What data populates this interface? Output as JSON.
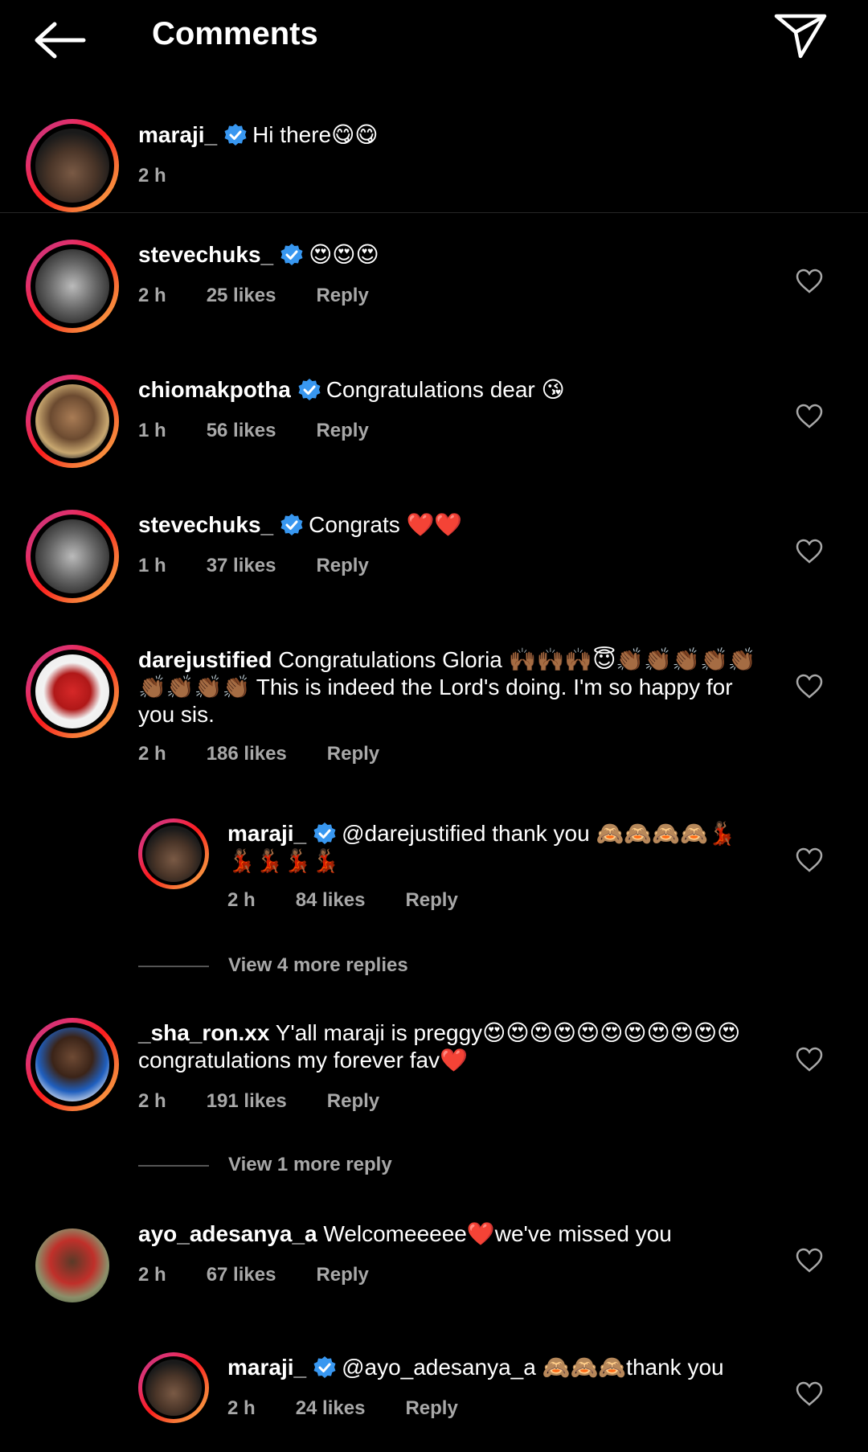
{
  "header": {
    "title": "Comments"
  },
  "caption": {
    "user": "maraji_",
    "text": "Hi there😋😋",
    "time": "2 h"
  },
  "comments": [
    {
      "user": "stevechuks_",
      "verified": true,
      "text": "😍😍😍",
      "time": "2 h",
      "likes": "25 likes",
      "reply": "Reply"
    },
    {
      "user": "chiomakpotha",
      "verified": true,
      "text": "Congratulations dear 😘",
      "time": "1 h",
      "likes": "56 likes",
      "reply": "Reply"
    },
    {
      "user": "stevechuks_",
      "verified": true,
      "text": "Congrats ❤️❤️",
      "time": "1 h",
      "likes": "37 likes",
      "reply": "Reply"
    },
    {
      "user": "darejustified",
      "verified": false,
      "text": "Congratulations Gloria 🙌🏾🙌🏾🙌🏾😇👏🏾👏🏾👏🏾👏🏾👏🏾👏🏾👏🏾👏🏾👏🏾 This is indeed the Lord's doing. I'm so happy for you sis.",
      "time": "2 h",
      "likes": "186 likes",
      "reply": "Reply"
    },
    {
      "user": "maraji_",
      "verified": true,
      "text": "@darejustified thank you 🙈🙈🙈🙈💃🏾💃🏾💃🏾💃🏾💃🏾",
      "time": "2 h",
      "likes": "84 likes",
      "reply": "Reply"
    },
    {
      "user": "_sha_ron.xx",
      "verified": false,
      "text": "Y'all maraji is preggy😍😍😍😍😍😍😍😍😍😍😍 congratulations my forever fav❤️",
      "time": "2 h",
      "likes": "191 likes",
      "reply": "Reply"
    },
    {
      "user": "ayo_adesanya_a",
      "verified": false,
      "text": "Welcomeeeee❤️we've missed you",
      "time": "2 h",
      "likes": "67 likes",
      "reply": "Reply"
    },
    {
      "user": "maraji_",
      "verified": true,
      "text": "@ayo_adesanya_a 🙈🙈🙈thank you",
      "time": "2 h",
      "likes": "24 likes",
      "reply": "Reply"
    }
  ],
  "view_more": [
    "View 4 more replies",
    "View 1 more reply"
  ],
  "colors": {
    "background": "#000000",
    "meta": "#a8a8a8",
    "verified": "#3897f0"
  }
}
